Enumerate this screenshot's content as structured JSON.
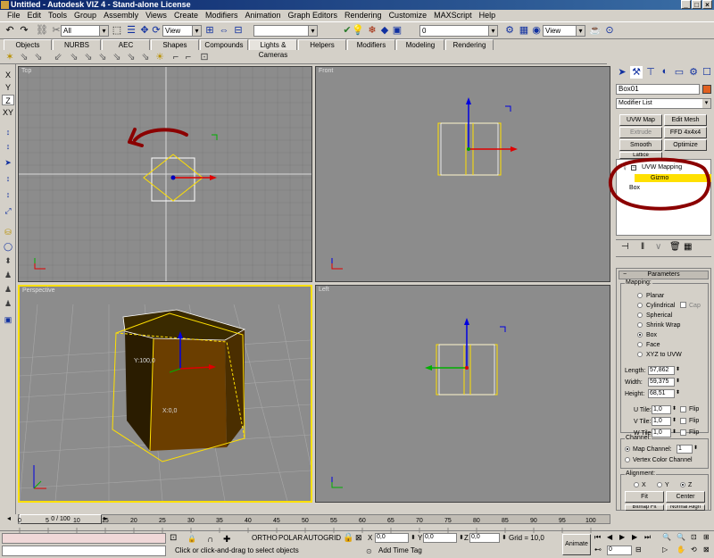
{
  "window": {
    "title": "Untitled - Autodesk VIZ 4 - Stand-alone License",
    "min": "_",
    "max": "□",
    "close": "×"
  },
  "menu": [
    "File",
    "Edit",
    "Tools",
    "Group",
    "Assembly",
    "Views",
    "Create",
    "Modifiers",
    "Animation",
    "Graph Editors",
    "Rendering",
    "Customize",
    "MAXScript",
    "Help"
  ],
  "toolbar": {
    "selection_filter": "All",
    "ref_coord": "View",
    "named_sel": "",
    "layer_value": "0",
    "view_combo": "View"
  },
  "tabs": [
    "Objects",
    "NURBS",
    "AEC",
    "Shapes",
    "Compounds",
    "Lights & Cameras",
    "Helpers",
    "Modifiers",
    "Modeling",
    "Rendering"
  ],
  "active_tab": "Lights & Cameras",
  "axis_buttons": [
    "X",
    "Y",
    "Z",
    "XY"
  ],
  "viewports": {
    "top": "Top",
    "front": "Front",
    "perspective": "Perspective",
    "left": "Left"
  },
  "persp_labels": {
    "y": "Y:100,0",
    "x": "X:0,0"
  },
  "panel": {
    "object_name": "Box01",
    "object_color": "#e06020",
    "modifier_list": "Modifier List",
    "buttons": [
      "UVW Map",
      "Edit Mesh",
      "Extrude",
      "FFD 4x4x4",
      "Smooth",
      "Optimize"
    ],
    "disabled_buttons": [
      "Extrude"
    ],
    "lattice": "Lattice",
    "stack": [
      "UVW Mapping",
      "Gizmo",
      "Box"
    ],
    "rollout": "Parameters",
    "mapping_group": "Mapping:",
    "mapping_options": [
      "Planar",
      "Cylindrical",
      "Spherical",
      "Shrink Wrap",
      "Box",
      "Face",
      "XYZ to UVW"
    ],
    "mapping_selected": "Box",
    "cap": "Cap",
    "length_label": "Length:",
    "length": "57,862",
    "width_label": "Width:",
    "width": "59,375",
    "height_label": "Height:",
    "height": "68,51",
    "u_tile_label": "U Tile:",
    "u_tile": "1,0",
    "v_tile_label": "V Tile:",
    "v_tile": "1,0",
    "w_tile_label": "W Tile:",
    "w_tile": "1,0",
    "flip": "Flip",
    "channel_group": "Channel:",
    "map_channel_label": "Map Channel:",
    "map_channel": "1",
    "vertex_color": "Vertex Color Channel",
    "alignment_group": "Alignment:",
    "align_axes": [
      "X",
      "Y",
      "Z"
    ],
    "align_selected": "Z",
    "fit": "Fit",
    "center": "Center",
    "bitmap_fit": "Bitmap Fit",
    "normal_align": "Normal Align"
  },
  "timeline": {
    "slider": "0 / 100",
    "ticks": [
      "0",
      "5",
      "10",
      "15",
      "20",
      "25",
      "30",
      "35",
      "40",
      "45",
      "50",
      "55",
      "60",
      "65",
      "70",
      "75",
      "80",
      "85",
      "90",
      "95",
      "100"
    ]
  },
  "status": {
    "ortho": "ORTHO",
    "polar": "POLAR",
    "autogrid": "AUTOGRID",
    "x_label": "X",
    "x": "0,0",
    "y_label": "Y",
    "y": "0,0",
    "z_label": "Z",
    "z": "0,0",
    "grid": "Grid = 10,0",
    "prompt": "Click or click-and-drag to select objects",
    "add_time_tag": "Add Time Tag",
    "animate": "Animate",
    "frame": "0"
  },
  "colors": {
    "annotation": "#8b0000",
    "selection": "#ffe000",
    "box": "#6b3e00",
    "viewport_bg": "#8c8c8c"
  }
}
